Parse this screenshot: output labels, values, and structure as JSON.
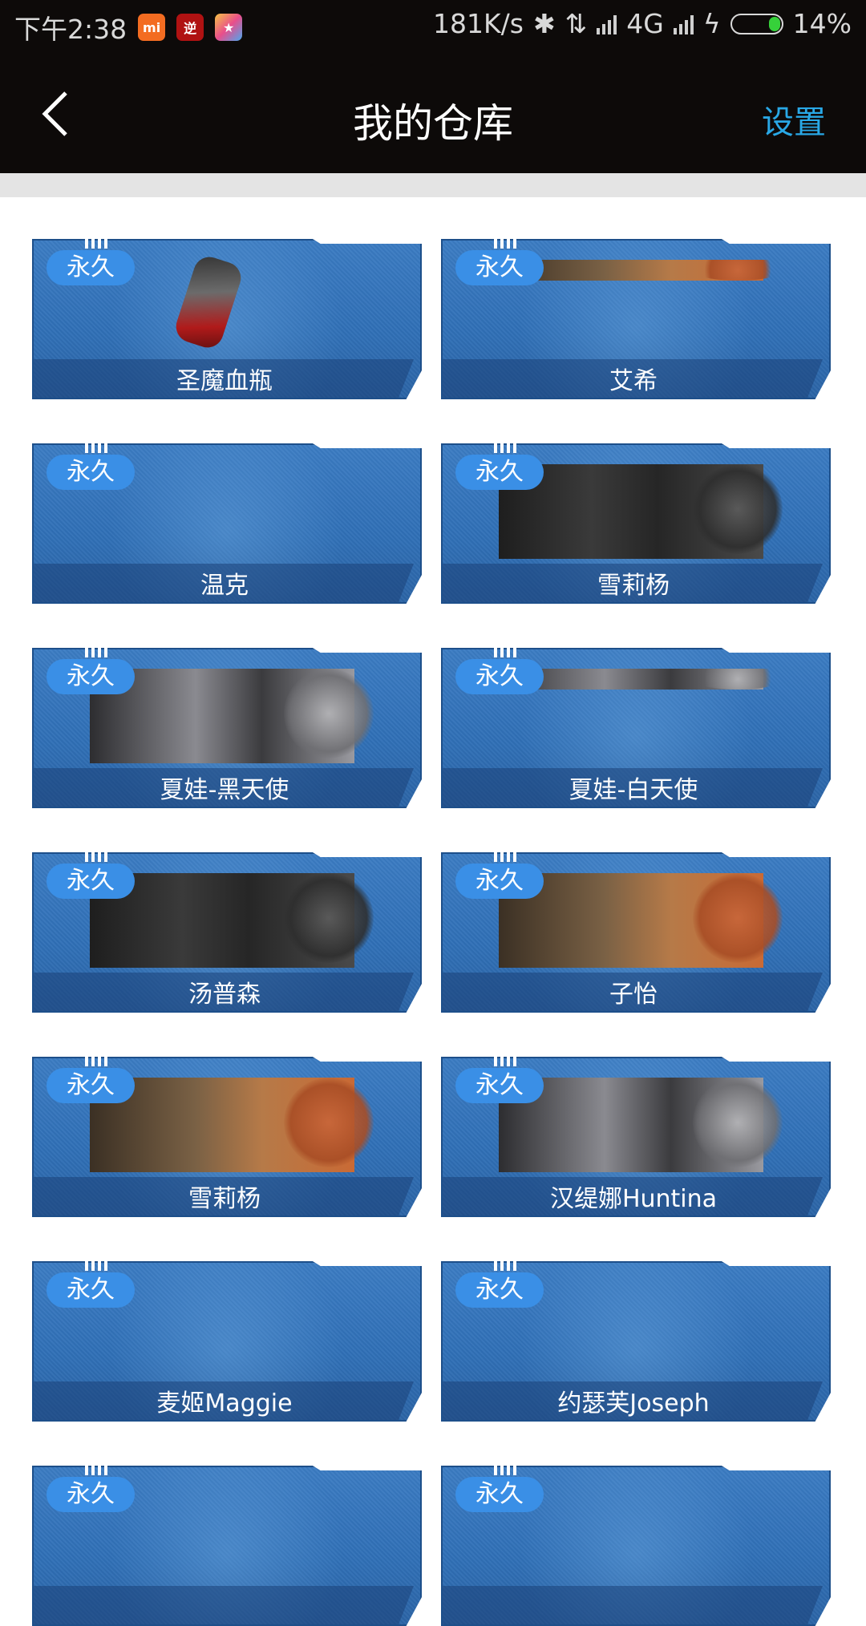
{
  "status_bar": {
    "time": "下午2:38",
    "app_icons": [
      "mi-icon",
      "game-icon",
      "star-app-icon"
    ],
    "network_speed": "181K/s",
    "network_type": "4G",
    "battery_percent": "14%"
  },
  "header": {
    "title": "我的仓库",
    "settings_label": "设置"
  },
  "items": [
    {
      "name": "圣魔血瓶",
      "badge": "永久",
      "has_image": true,
      "image_type": "item"
    },
    {
      "name": "艾希",
      "badge": "永久",
      "has_image": true,
      "image_type": "fist"
    },
    {
      "name": "温克",
      "badge": "永久",
      "has_image": false,
      "image_type": ""
    },
    {
      "name": "雪莉杨",
      "badge": "永久",
      "has_image": true,
      "image_type": "sword"
    },
    {
      "name": "夏娃-黑天使",
      "badge": "永久",
      "has_image": true,
      "image_type": "star"
    },
    {
      "name": "夏娃-白天使",
      "badge": "永久",
      "has_image": true,
      "image_type": "star"
    },
    {
      "name": "汤普森",
      "badge": "永久",
      "has_image": true,
      "image_type": "sword"
    },
    {
      "name": "子怡",
      "badge": "永久",
      "has_image": true,
      "image_type": "fist"
    },
    {
      "name": "雪莉杨",
      "badge": "永久",
      "has_image": true,
      "image_type": "fist"
    },
    {
      "name": "汉缇娜Huntina",
      "badge": "永久",
      "has_image": true,
      "image_type": "star"
    },
    {
      "name": "麦姬Maggie",
      "badge": "永久",
      "has_image": false,
      "image_type": ""
    },
    {
      "name": "约瑟芙Joseph",
      "badge": "永久",
      "has_image": false,
      "image_type": ""
    },
    {
      "name": "",
      "badge": "永久",
      "has_image": false,
      "image_type": ""
    },
    {
      "name": "",
      "badge": "永久",
      "has_image": false,
      "image_type": ""
    }
  ],
  "colors": {
    "accent": "#29a8e6",
    "header_bg": "#0d0a09",
    "card_blue": "#2f6fb6",
    "badge_blue": "#3a8fe6"
  }
}
